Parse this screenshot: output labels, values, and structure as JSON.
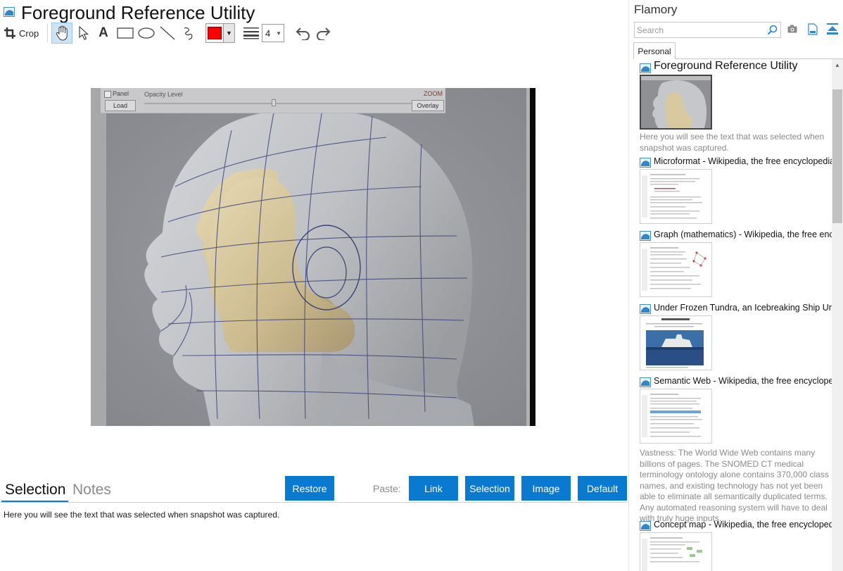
{
  "window": {
    "title": "Foreground Reference Utility"
  },
  "toolbar": {
    "crop_label": "Crop",
    "color": "#ff0000",
    "line_width": "4"
  },
  "snapshot_image": {
    "panel_label": "Panel",
    "opacity_label": "Opacity Level",
    "zoom_label": "ZOOM",
    "load_label": "Load",
    "overlay_label": "Overlay"
  },
  "bottom": {
    "tab_selection": "Selection",
    "tab_notes": "Notes",
    "restore_label": "Restore",
    "paste_label": "Paste:",
    "paste_buttons": [
      "Link",
      "Selection",
      "Image",
      "Default"
    ],
    "selection_text": "Here you will see the text that was selected when snapshot was captured."
  },
  "sidebar": {
    "app_name": "Flamory",
    "search_placeholder": "Search",
    "tab_personal": "Personal",
    "snapshots": [
      {
        "title": "Foreground Reference Utility",
        "description": "Here you will see the text that was selected when snapshot was captured."
      },
      {
        "title": "Microformat - Wikipedia, the free encyclopedia"
      },
      {
        "title": "Graph (mathematics) - Wikipedia, the free ency"
      },
      {
        "title": "Under Frozen Tundra, an Icebreaking Ship Unco"
      },
      {
        "title": "Semantic Web - Wikipedia, the free encycloped",
        "description": "Vastness: The World Wide Web contains many billions of pages. The SNOMED CT medical terminology ontology alone contains 370,000 class names, and existing technology has not yet been able to eliminate all semantically duplicated terms. Any automated reasoning system will have to deal with truly huge inputs."
      },
      {
        "title": "Concept map - Wikipedia, the free encyclopedia"
      }
    ]
  },
  "colors": {
    "accent": "#0a7ad1",
    "selected_tool": "#cce4f7"
  }
}
